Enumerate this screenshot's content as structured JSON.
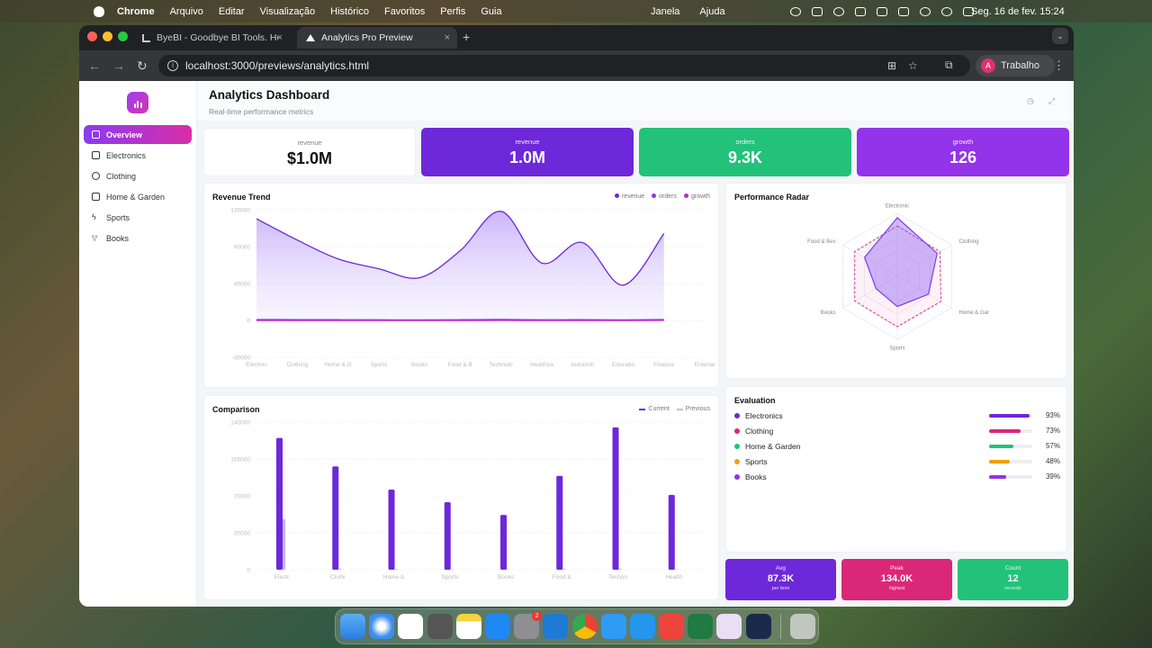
{
  "menubar": {
    "app": "Chrome",
    "items": [
      "Arquivo",
      "Editar",
      "Visualização",
      "Histórico",
      "Favoritos",
      "Perfis",
      "Guia"
    ],
    "center": [
      "Janela",
      "Ajuda"
    ],
    "clock": "Seg. 16 de fev.  15:24"
  },
  "browser": {
    "tabs": [
      {
        "title": "ByeBI - Goodbye BI Tools. He"
      },
      {
        "title": "Analytics Pro Preview"
      }
    ],
    "new_tab": "+",
    "close": "×",
    "url": "localhost:3000/previews/analytics.html",
    "profile": {
      "initial": "A",
      "name": "Trabalho"
    }
  },
  "sidebar": {
    "items": [
      {
        "label": "Overview",
        "icon": "home-icon",
        "active": true
      },
      {
        "label": "Electronics",
        "icon": "bar-chart-icon"
      },
      {
        "label": "Clothing",
        "icon": "check-circle-icon"
      },
      {
        "label": "Home & Garden",
        "icon": "house-icon"
      },
      {
        "label": "Sports",
        "icon": "bolt-icon"
      },
      {
        "label": "Books",
        "icon": "filter-icon"
      }
    ]
  },
  "header": {
    "title": "Analytics Dashboard",
    "subtitle": "Real-time performance metrics"
  },
  "kpis": [
    {
      "label": "revenue",
      "value": "$1.0M",
      "color": "#ffffff"
    },
    {
      "label": "revenue",
      "value": "1.0M",
      "color": "#6d28d9"
    },
    {
      "label": "orders",
      "value": "9.3K",
      "color": "#22c27a"
    },
    {
      "label": "growth",
      "value": "126",
      "color": "#9333ea"
    }
  ],
  "trend": {
    "title": "Revenue Trend",
    "legend": [
      "revenue",
      "orders",
      "growth"
    ],
    "chart_data": {
      "type": "area",
      "title": "Revenue Trend",
      "x": [
        "Electron",
        "Clothing",
        "Home & G",
        "Sports",
        "Books",
        "Food & B",
        "Technolo",
        "Healthca",
        "Automoti",
        "Educatio",
        "Finance",
        "Entertai"
      ],
      "ylim": [
        -45000,
        135000
      ],
      "yticks": [
        "135000",
        "90000",
        "45000",
        "0",
        "-45000"
      ],
      "series": [
        {
          "name": "revenue",
          "values": [
            124000,
            98000,
            75000,
            63000,
            52000,
            85000,
            133000,
            70000,
            95000,
            43000,
            106000,
            null
          ],
          "color": "#6d28d9"
        },
        {
          "name": "orders",
          "values": [
            900,
            800,
            700,
            600,
            500,
            700,
            1000,
            600,
            800,
            500,
            900,
            null
          ],
          "color": "#9333ea"
        },
        {
          "name": "growth",
          "values": [
            120,
            110,
            100,
            90,
            80,
            100,
            130,
            90,
            110,
            70,
            126,
            null
          ],
          "color": "#c026d3"
        }
      ]
    }
  },
  "radar": {
    "title": "Performance Radar",
    "chart_data": {
      "type": "radar",
      "axes": [
        "Electronic",
        "Clothing",
        "Home & Gar",
        "Sports",
        "Books",
        "Food & Bev"
      ],
      "series": [
        {
          "name": "current",
          "values": [
            93,
            73,
            57,
            48,
            39,
            60
          ],
          "color": "#7c3aed"
        },
        {
          "name": "previous",
          "values": [
            80,
            78,
            80,
            80,
            78,
            78
          ],
          "color": "#db2777"
        }
      ]
    }
  },
  "comparison": {
    "title": "Comparison",
    "legend": [
      "Current",
      "Previous"
    ],
    "chart_data": {
      "type": "bar",
      "categories": [
        "Electr",
        "Clothi",
        "Home &",
        "Sports",
        "Books",
        "Food &",
        "Techno",
        "Health"
      ],
      "ylim": [
        0,
        140000
      ],
      "yticks": [
        "140000",
        "105000",
        "70000",
        "35000",
        "0"
      ],
      "series": [
        {
          "name": "Current",
          "values": [
            125000,
            98000,
            76000,
            64000,
            52000,
            89000,
            135000,
            71000
          ],
          "color": "#6d28d9"
        },
        {
          "name": "Previous",
          "values": [
            48000,
            900,
            700,
            600,
            500,
            800,
            1000,
            600
          ],
          "color": "#c4b5fd"
        }
      ]
    }
  },
  "evaluation": {
    "title": "Evaluation",
    "rows": [
      {
        "label": "Electronics",
        "pct": "93%",
        "value": 0.93,
        "color": "#6d28d9"
      },
      {
        "label": "Clothing",
        "pct": "73%",
        "value": 0.73,
        "color": "#db2777"
      },
      {
        "label": "Home & Garden",
        "pct": "57%",
        "value": 0.57,
        "color": "#22c27a"
      },
      {
        "label": "Sports",
        "pct": "48%",
        "value": 0.48,
        "color": "#f59e0b"
      },
      {
        "label": "Books",
        "pct": "39%",
        "value": 0.39,
        "color": "#9333ea"
      }
    ]
  },
  "stats": [
    {
      "label": "Avg",
      "value": "87.3K",
      "sub": "per item",
      "color": "#6d28d9"
    },
    {
      "label": "Peak",
      "value": "134.0K",
      "sub": "highest",
      "color": "#db2777"
    },
    {
      "label": "Count",
      "value": "12",
      "sub": "records",
      "color": "#22c27a"
    }
  ],
  "dock": {
    "badge": "2",
    "icons": [
      "finder-icon",
      "safari-icon",
      "calendar-icon",
      "calculator-icon",
      "notes-icon",
      "app-store-icon",
      "system-settings-icon",
      "vscode-icon",
      "chrome-icon",
      "xcode-icon",
      "docker-icon",
      "anydesk-icon",
      "excel-icon",
      "monitor-icon",
      "ai-app-icon",
      "trash-icon"
    ]
  }
}
